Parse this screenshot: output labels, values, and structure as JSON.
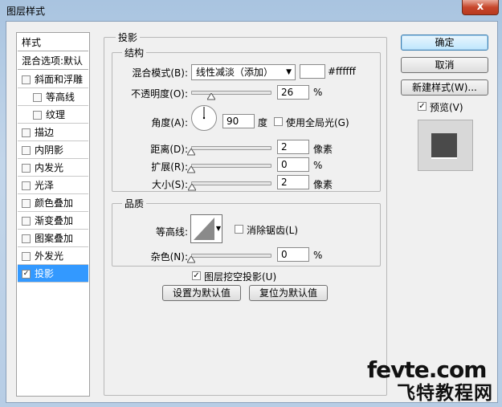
{
  "window": {
    "title": "图层样式",
    "close_glyph": "x"
  },
  "sidebar": {
    "header": "样式",
    "blend_options": "混合选项:默认",
    "items": [
      {
        "label": "斜面和浮雕",
        "checked": false,
        "indent": false
      },
      {
        "label": "等高线",
        "checked": false,
        "indent": true
      },
      {
        "label": "纹理",
        "checked": false,
        "indent": true
      },
      {
        "label": "描边",
        "checked": false,
        "indent": false
      },
      {
        "label": "内阴影",
        "checked": false,
        "indent": false
      },
      {
        "label": "内发光",
        "checked": false,
        "indent": false
      },
      {
        "label": "光泽",
        "checked": false,
        "indent": false
      },
      {
        "label": "颜色叠加",
        "checked": false,
        "indent": false
      },
      {
        "label": "渐变叠加",
        "checked": false,
        "indent": false
      },
      {
        "label": "图案叠加",
        "checked": false,
        "indent": false
      },
      {
        "label": "外发光",
        "checked": false,
        "indent": false
      },
      {
        "label": "投影",
        "checked": true,
        "indent": false,
        "selected": true
      }
    ]
  },
  "panel": {
    "title": "投影",
    "structure": {
      "title": "结构",
      "blend_mode_label": "混合模式(B):",
      "blend_mode_value": "线性减淡（添加）",
      "color_value": "#ffffff",
      "color_hex_text": "#ffffff",
      "opacity_label": "不透明度(O):",
      "opacity_value": "26",
      "opacity_unit": "%",
      "angle_label": "角度(A):",
      "angle_value": "90",
      "angle_unit": "度",
      "global_light_label": "使用全局光(G)",
      "global_light_checked": false,
      "distance_label": "距离(D):",
      "distance_value": "2",
      "distance_unit": "像素",
      "spread_label": "扩展(R):",
      "spread_value": "0",
      "spread_unit": "%",
      "size_label": "大小(S):",
      "size_value": "2",
      "size_unit": "像素"
    },
    "quality": {
      "title": "品质",
      "contour_label": "等高线:",
      "antialias_label": "消除锯齿(L)",
      "antialias_checked": false,
      "noise_label": "杂色(N):",
      "noise_value": "0",
      "noise_unit": "%"
    },
    "knockout_label": "图层挖空投影(U)",
    "knockout_checked": true,
    "make_default_label": "设置为默认值",
    "reset_default_label": "复位为默认值"
  },
  "buttons": {
    "ok": "确定",
    "cancel": "取消",
    "new_style": "新建样式(W)...",
    "preview_label": "预览(V)",
    "preview_checked": true
  },
  "watermark": {
    "line1": "fevte.com",
    "line2": "飞特教程网"
  },
  "colors": {
    "selection": "#3399ff",
    "preview_square": "#4a4a4a"
  }
}
